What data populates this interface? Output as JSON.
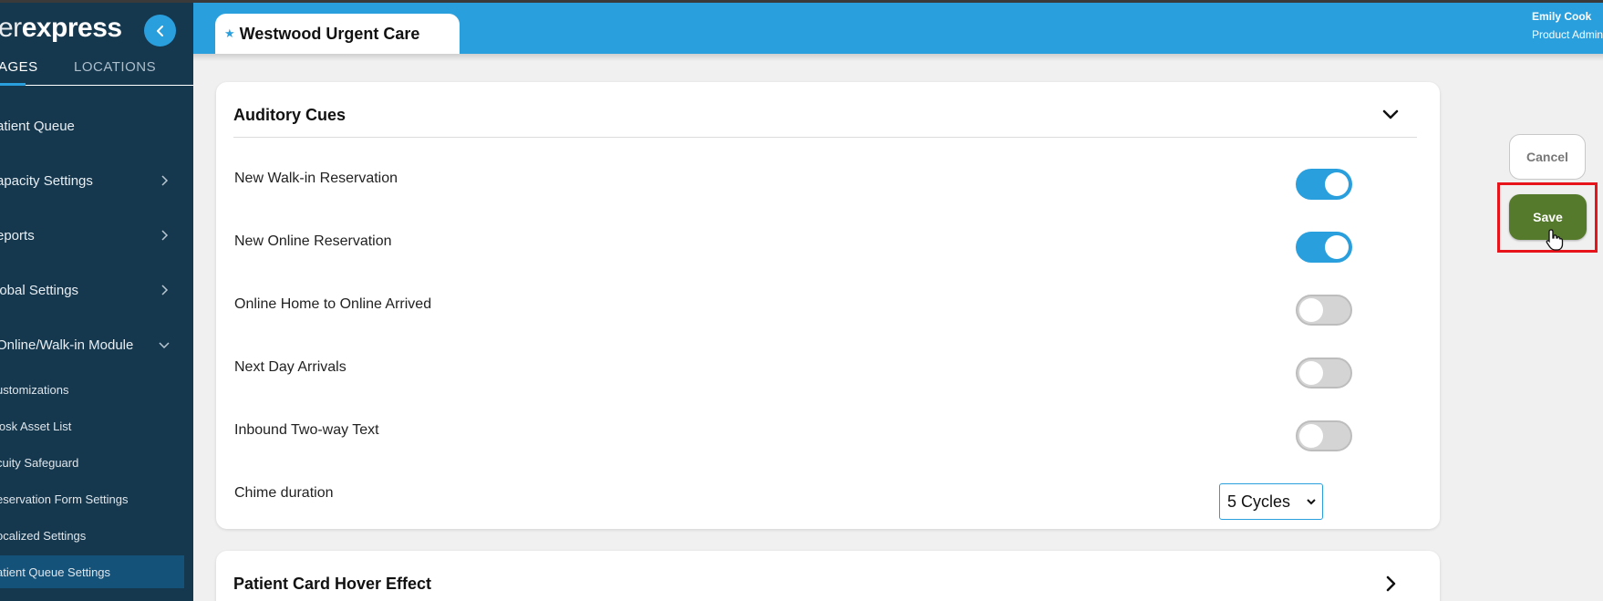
{
  "sidebar": {
    "logo_light": "er",
    "logo_bold": "express",
    "tabs": [
      {
        "label": "AGES"
      },
      {
        "label": "LOCATIONS"
      }
    ],
    "items": [
      {
        "label": "atient Queue"
      },
      {
        "label": "apacity Settings"
      },
      {
        "label": "eports"
      },
      {
        "label": "lobal Settings"
      },
      {
        "label": "Online/Walk-in Module"
      }
    ],
    "sub_items": [
      {
        "label": "ustomizations"
      },
      {
        "label": "iosk Asset List"
      },
      {
        "label": "cuity Safeguard"
      },
      {
        "label": "eservation Form Settings"
      },
      {
        "label": "ocalized Settings"
      },
      {
        "label": "atient Queue Settings"
      }
    ]
  },
  "header": {
    "location_name": "Westwood Urgent Care",
    "user_name": "Emily Cook",
    "user_role": "Product Admin"
  },
  "auditory_cues": {
    "title": "Auditory Cues",
    "settings": [
      {
        "label": "New Walk-in Reservation",
        "enabled": true
      },
      {
        "label": "New Online Reservation",
        "enabled": true
      },
      {
        "label": "Online Home to Online Arrived",
        "enabled": false
      },
      {
        "label": "Next Day Arrivals",
        "enabled": false
      },
      {
        "label": "Inbound Two-way Text",
        "enabled": false
      }
    ],
    "chime_label": "Chime duration",
    "chime_value": "5 Cycles"
  },
  "patient_card": {
    "title": "Patient Card Hover Effect"
  },
  "actions": {
    "cancel_label": "Cancel",
    "save_label": "Save"
  },
  "colors": {
    "sidebar_bg": "#15384f",
    "accent": "#2a9fde",
    "save_green": "#567a2b",
    "highlight_red": "#e8141c"
  }
}
